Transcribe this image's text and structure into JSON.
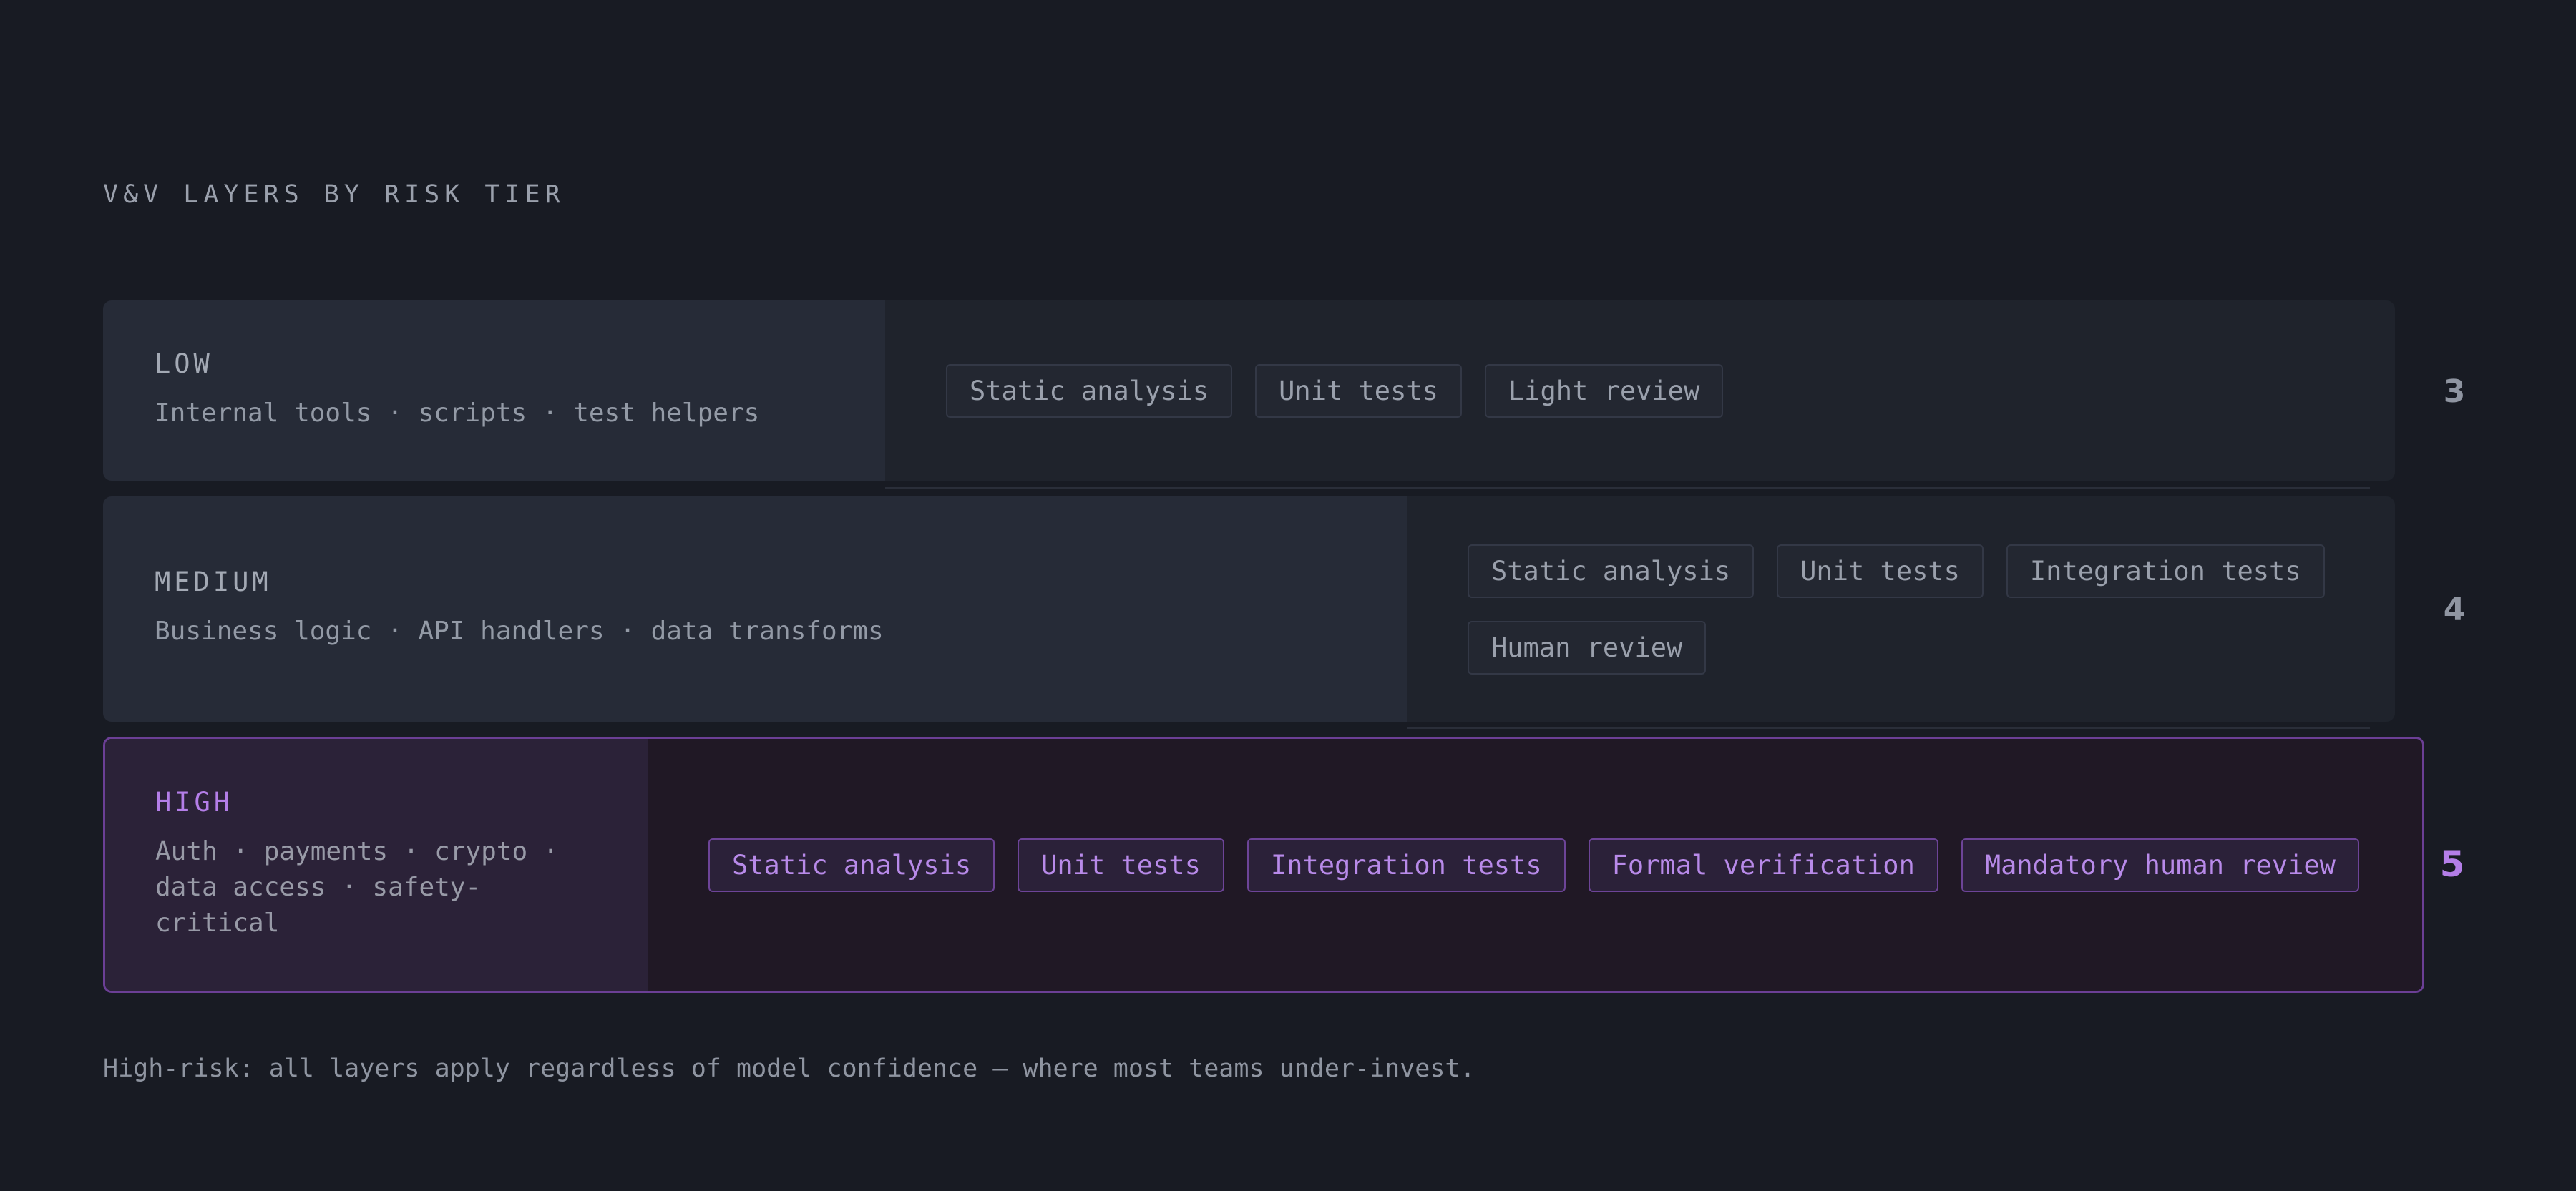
{
  "heading": "V&V LAYERS BY RISK TIER",
  "tiers": [
    {
      "name": "LOW",
      "description": "Internal tools · scripts · test helpers",
      "layers": [
        "Static analysis",
        "Unit tests",
        "Light review"
      ],
      "count": "3"
    },
    {
      "name": "MEDIUM",
      "description": "Business logic · API handlers · data transforms",
      "layers": [
        "Static analysis",
        "Unit tests",
        "Integration tests",
        "Human review"
      ],
      "count": "4"
    },
    {
      "name": "HIGH",
      "description": "Auth · payments · crypto · data access · safety-critical",
      "layers": [
        "Static analysis",
        "Unit tests",
        "Integration tests",
        "Formal verification",
        "Mandatory human review"
      ],
      "count": "5"
    }
  ],
  "footnote": "High-risk: all layers apply regardless of model confidence — where most teams under-invest.",
  "colors": {
    "background": "#181b23",
    "accent": "#b47ee8",
    "high_border": "#6b3f95"
  }
}
